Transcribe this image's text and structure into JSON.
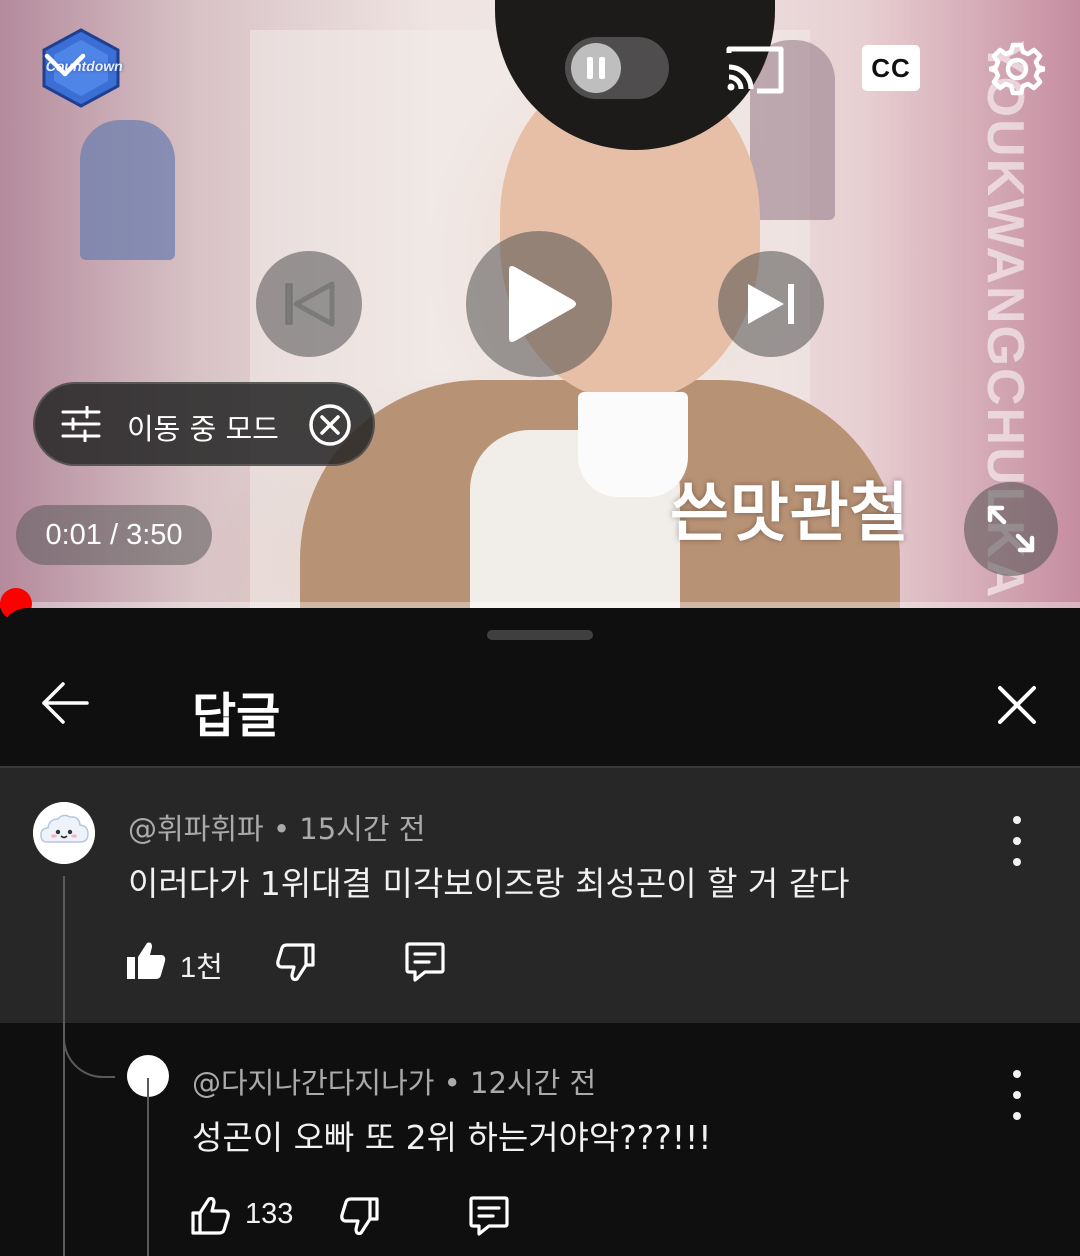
{
  "player": {
    "channel_logo_text": "Countdown",
    "watermark_text": "YOUKWANGCHULKA",
    "cc_label": "CC",
    "mode_chip_label": "이동 중 모드",
    "time_display": "0:01 / 3:50",
    "caption_text": "쓴맛관철",
    "progress": {
      "current_seconds": 1,
      "duration_seconds": 230
    }
  },
  "panel": {
    "title": "답글"
  },
  "comments": [
    {
      "handle": "@휘파휘파",
      "time": "15시간 전",
      "text": "이러다가 1위대결 미각보이즈랑 최성곤이 할 거 같다",
      "likes": "1천",
      "liked": true
    },
    {
      "handle": "@다지나간다지나가",
      "time": "12시간 전",
      "text": "성곤이 오빠 또 2위 하는거야악???!!!",
      "likes": "133",
      "liked": false
    }
  ],
  "colors": {
    "accent_red": "#ff0000",
    "panel_bg": "#0f0f0f",
    "highlight_bg": "#272727",
    "meta_gray": "#aaaaaa"
  }
}
